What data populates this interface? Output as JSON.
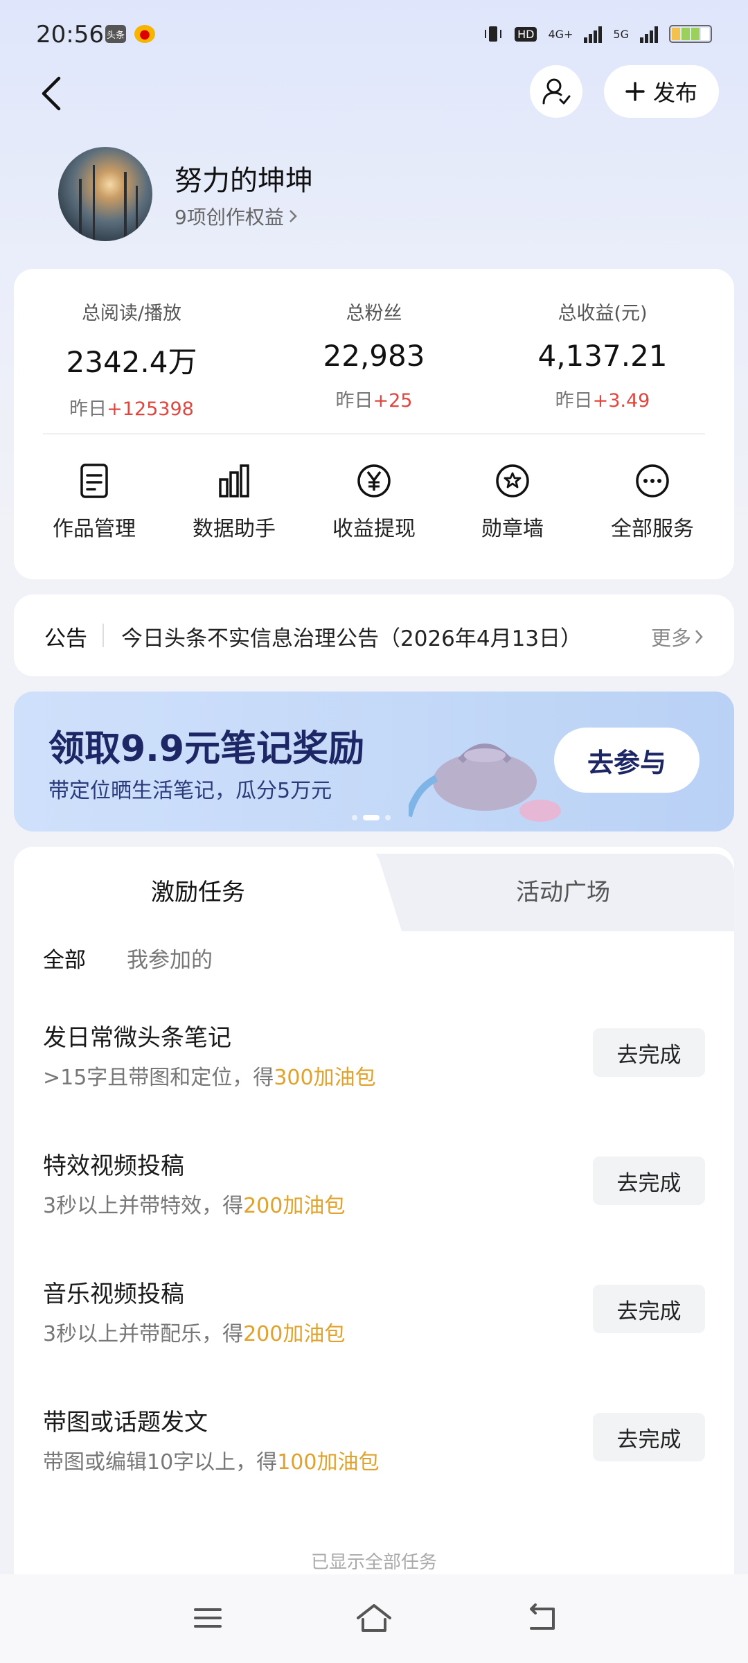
{
  "status_bar": {
    "time": "20:56",
    "app_icons": [
      "头条",
      "weibo-icon"
    ],
    "network": [
      "HD",
      "4G+",
      "5G"
    ]
  },
  "header": {
    "back_icon": "back-arrow-icon",
    "user_icon": "user-check-icon",
    "publish_label": "发布"
  },
  "profile": {
    "name": "努力的坤坤",
    "rights": "9项创作权益"
  },
  "stats": [
    {
      "label": "总阅读/播放",
      "value": "2342.4万",
      "delta_prefix": "昨日",
      "delta": "+125398"
    },
    {
      "label": "总粉丝",
      "value": "22,983",
      "delta_prefix": "昨日",
      "delta": "+25"
    },
    {
      "label": "总收益(元)",
      "value": "4,137.21",
      "delta_prefix": "昨日",
      "delta": "+3.49"
    }
  ],
  "tools": [
    {
      "label": "作品管理",
      "icon": "document-icon"
    },
    {
      "label": "数据助手",
      "icon": "bar-chart-icon"
    },
    {
      "label": "收益提现",
      "icon": "yen-icon"
    },
    {
      "label": "勋章墙",
      "icon": "badge-icon"
    },
    {
      "label": "全部服务",
      "icon": "more-icon"
    }
  ],
  "notice": {
    "tag": "公告",
    "text": "今日头条不实信息治理公告（2026年4月13日）",
    "more": "更多"
  },
  "banner": {
    "title": "领取9.9元笔记奖励",
    "subtitle": "带定位晒生活笔记，瓜分5万元",
    "cta": "去参与",
    "colors": {
      "title": "#1d2766",
      "background": "#c4d9f8"
    }
  },
  "tasks": {
    "tabs": [
      "激励任务",
      "活动广场"
    ],
    "filters": [
      "全部",
      "我参加的"
    ],
    "items": [
      {
        "title": "发日常微头条笔记",
        "desc": ">15字且带图和定位，得",
        "reward": "300加油包",
        "button": "去完成"
      },
      {
        "title": "特效视频投稿",
        "desc": "3秒以上并带特效，得",
        "reward": "200加油包",
        "button": "去完成"
      },
      {
        "title": "音乐视频投稿",
        "desc": "3秒以上并带配乐，得",
        "reward": "200加油包",
        "button": "去完成"
      },
      {
        "title": "带图或话题发文",
        "desc": "带图或编辑10字以上，得",
        "reward": "100加油包",
        "button": "去完成"
      }
    ],
    "footer": "已显示全部任务",
    "reward_color": "#e0a22a"
  },
  "nav": [
    "menu-icon",
    "home-icon",
    "back-icon"
  ]
}
